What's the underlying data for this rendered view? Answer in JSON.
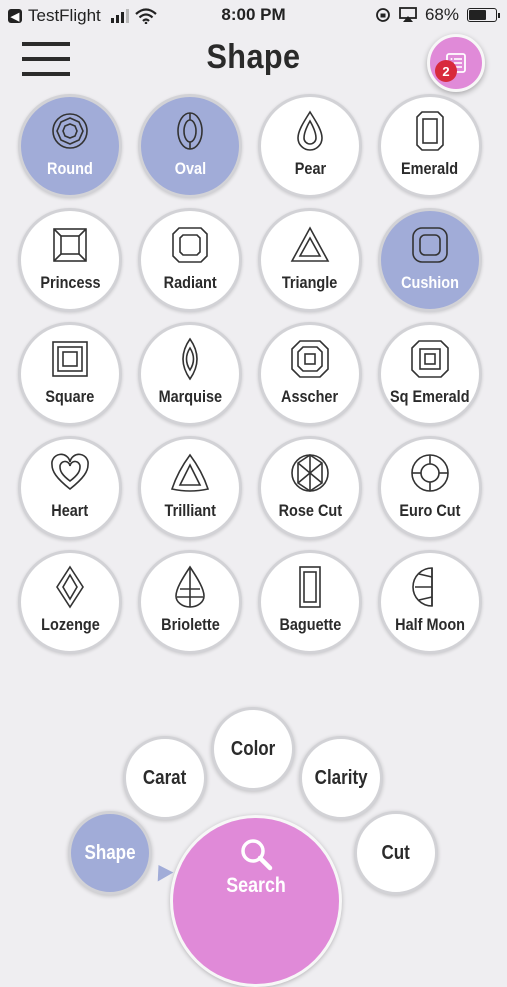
{
  "status_bar": {
    "carrier": "TestFlight",
    "time": "8:00 PM",
    "battery": "68%",
    "battery_level": 0.68
  },
  "header": {
    "title": "Shape",
    "badge_count": "2"
  },
  "shapes": [
    {
      "label": "Round",
      "icon": "round-diamond-icon",
      "selected": true
    },
    {
      "label": "Oval",
      "icon": "oval-diamond-icon",
      "selected": true
    },
    {
      "label": "Pear",
      "icon": "pear-diamond-icon",
      "selected": false
    },
    {
      "label": "Emerald",
      "icon": "emerald-diamond-icon",
      "selected": false
    },
    {
      "label": "Princess",
      "icon": "princess-diamond-icon",
      "selected": false
    },
    {
      "label": "Radiant",
      "icon": "radiant-diamond-icon",
      "selected": false
    },
    {
      "label": "Triangle",
      "icon": "triangle-diamond-icon",
      "selected": false
    },
    {
      "label": "Cushion",
      "icon": "cushion-diamond-icon",
      "selected": true
    },
    {
      "label": "Square",
      "icon": "square-diamond-icon",
      "selected": false
    },
    {
      "label": "Marquise",
      "icon": "marquise-diamond-icon",
      "selected": false
    },
    {
      "label": "Asscher",
      "icon": "asscher-diamond-icon",
      "selected": false
    },
    {
      "label": "Sq Emerald",
      "icon": "sq-emerald-diamond-icon",
      "selected": false
    },
    {
      "label": "Heart",
      "icon": "heart-diamond-icon",
      "selected": false
    },
    {
      "label": "Trilliant",
      "icon": "trilliant-diamond-icon",
      "selected": false
    },
    {
      "label": "Rose Cut",
      "icon": "rose-cut-diamond-icon",
      "selected": false
    },
    {
      "label": "Euro Cut",
      "icon": "euro-cut-diamond-icon",
      "selected": false
    },
    {
      "label": "Lozenge",
      "icon": "lozenge-diamond-icon",
      "selected": false
    },
    {
      "label": "Briolette",
      "icon": "briolette-diamond-icon",
      "selected": false
    },
    {
      "label": "Baguette",
      "icon": "baguette-diamond-icon",
      "selected": false
    },
    {
      "label": "Half Moon",
      "icon": "half-moon-diamond-icon",
      "selected": false
    }
  ],
  "nav": {
    "shape": "Shape",
    "carat": "Carat",
    "color": "Color",
    "clarity": "Clarity",
    "cut": "Cut",
    "search": "Search"
  },
  "colors": {
    "selected": "#a1acd8",
    "accent": "#e08ad8",
    "badge": "#d82a3c",
    "background": "#efeef1"
  }
}
